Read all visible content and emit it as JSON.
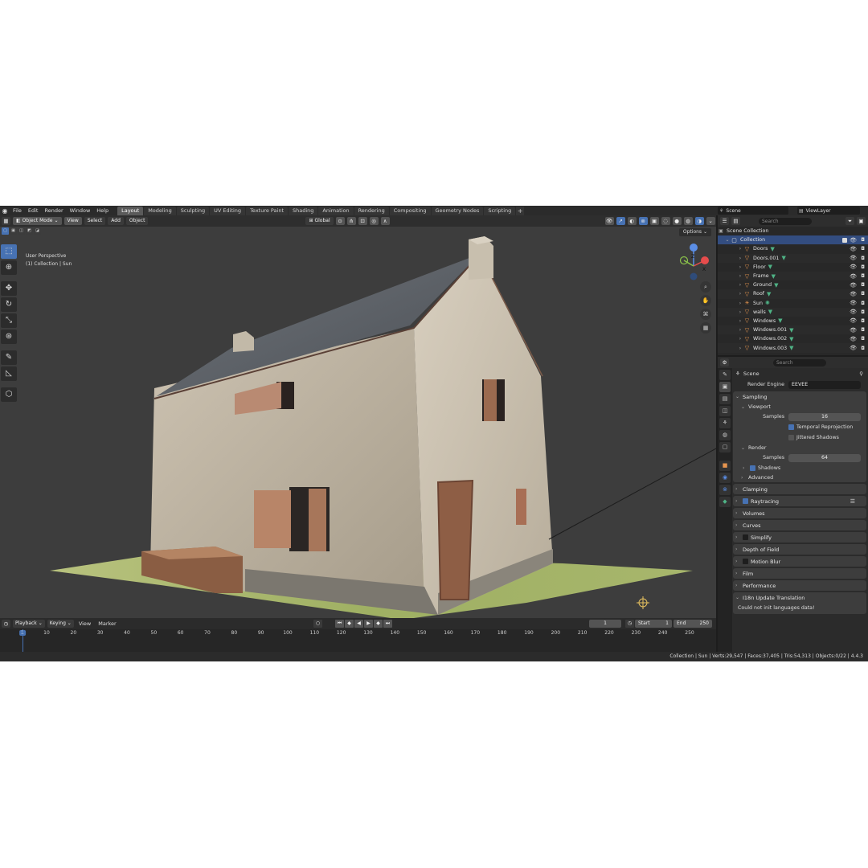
{
  "menu": [
    "File",
    "Edit",
    "Render",
    "Window",
    "Help"
  ],
  "workspaces": [
    "Layout",
    "Modeling",
    "Sculpting",
    "UV Editing",
    "Texture Paint",
    "Shading",
    "Animation",
    "Rendering",
    "Compositing",
    "Geometry Nodes",
    "Scripting"
  ],
  "scene_name": "Scene",
  "view_layer": "ViewLayer",
  "viewport": {
    "mode": "Object Mode",
    "menus": [
      "View",
      "Select",
      "Add",
      "Object"
    ],
    "orientation": "Global",
    "info_line1": "User Perspective",
    "info_line2": "(1) Collection | Sun",
    "options_label": "Options",
    "gizmo_z": "Z",
    "gizmo_x": "X"
  },
  "timeline": {
    "menus": [
      "Playback",
      "Keying",
      "View",
      "Marker"
    ],
    "current_frame": "1",
    "start_label": "Start",
    "start": "1",
    "end_label": "End",
    "end": "250",
    "ticks": [
      "1",
      "10",
      "20",
      "30",
      "40",
      "50",
      "60",
      "70",
      "80",
      "90",
      "100",
      "110",
      "120",
      "130",
      "140",
      "150",
      "160",
      "170",
      "180",
      "190",
      "200",
      "210",
      "220",
      "230",
      "240",
      "250"
    ]
  },
  "status": "Collection | Sun | Verts:29,547 | Faces:37,405 | Tris:54,313 | Objects:0/22 | 4.4.3",
  "outliner": {
    "search_placeholder": "Search",
    "root": "Scene Collection",
    "collection": "Collection",
    "items": [
      "Doors",
      "Doors.001",
      "Floor",
      "Frame",
      "Ground",
      "Roof",
      "Sun",
      "walls",
      "Windows",
      "Windows.001",
      "Windows.002",
      "Windows.003"
    ]
  },
  "properties": {
    "search_placeholder": "Search",
    "context": "Scene",
    "render_engine_label": "Render Engine",
    "render_engine": "EEVEE",
    "sampling": "Sampling",
    "viewport_sub": "Viewport",
    "samples_label": "Samples",
    "viewport_samples": "16",
    "temporal_reprojection": "Temporal Reprojection",
    "jittered_shadows": "Jittered Shadows",
    "render_sub": "Render",
    "render_samples": "64",
    "shadows": "Shadows",
    "advanced": "Advanced",
    "clamping": "Clamping",
    "raytracing": "Raytracing",
    "volumes": "Volumes",
    "curves": "Curves",
    "simplify": "Simplify",
    "depth_of_field": "Depth of Field",
    "motion_blur": "Motion Blur",
    "film": "Film",
    "performance": "Performance",
    "i18n": "I18n Update Translation",
    "i18n_msg": "Could not init languages data!"
  },
  "colors": {
    "accent": "#4772b3",
    "object_orange": "#e6954f",
    "data_green": "#4fb386",
    "viewport_bg": "#3d3d3d"
  }
}
